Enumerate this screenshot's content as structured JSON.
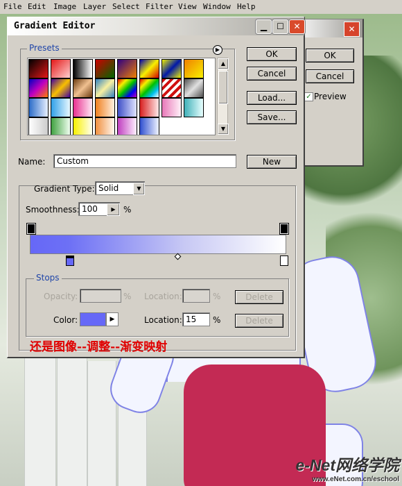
{
  "menubar": {
    "items": [
      "File",
      "Edit",
      "Image",
      "Layer",
      "Select",
      "Filter",
      "View",
      "Window",
      "Help"
    ]
  },
  "back_dialog": {
    "ok_label": "OK",
    "cancel_label": "Cancel",
    "preview_label": "Preview",
    "preview_checked": true
  },
  "dialog": {
    "title": "Gradient Editor",
    "presets_label": "Presets",
    "presets_menu_icon": "flyout-arrow-icon",
    "buttons": {
      "ok": "OK",
      "cancel": "Cancel",
      "load": "Load...",
      "save": "Save...",
      "new": "New"
    },
    "name_label": "Name:",
    "name_value": "Custom",
    "gradient_type_label": "Gradient Type:",
    "gradient_type_value": "Solid",
    "smoothness_label": "Smoothness:",
    "smoothness_value": "100",
    "smoothness_unit": "%",
    "stops_label": "Stops",
    "opacity_label": "Opacity:",
    "opacity_unit": "%",
    "opacity_location_label": "Location:",
    "opacity_location_unit": "%",
    "delete_label": "Delete",
    "color_label": "Color:",
    "color_value": "#6668f7",
    "color_location_label": "Location:",
    "color_location_value": "15",
    "color_location_unit": "%"
  },
  "notice": "还是图像--调整--渐变映射",
  "watermark": {
    "brand": "e-Net网络学院",
    "url": "www.eNet.com.cn/eschool"
  }
}
